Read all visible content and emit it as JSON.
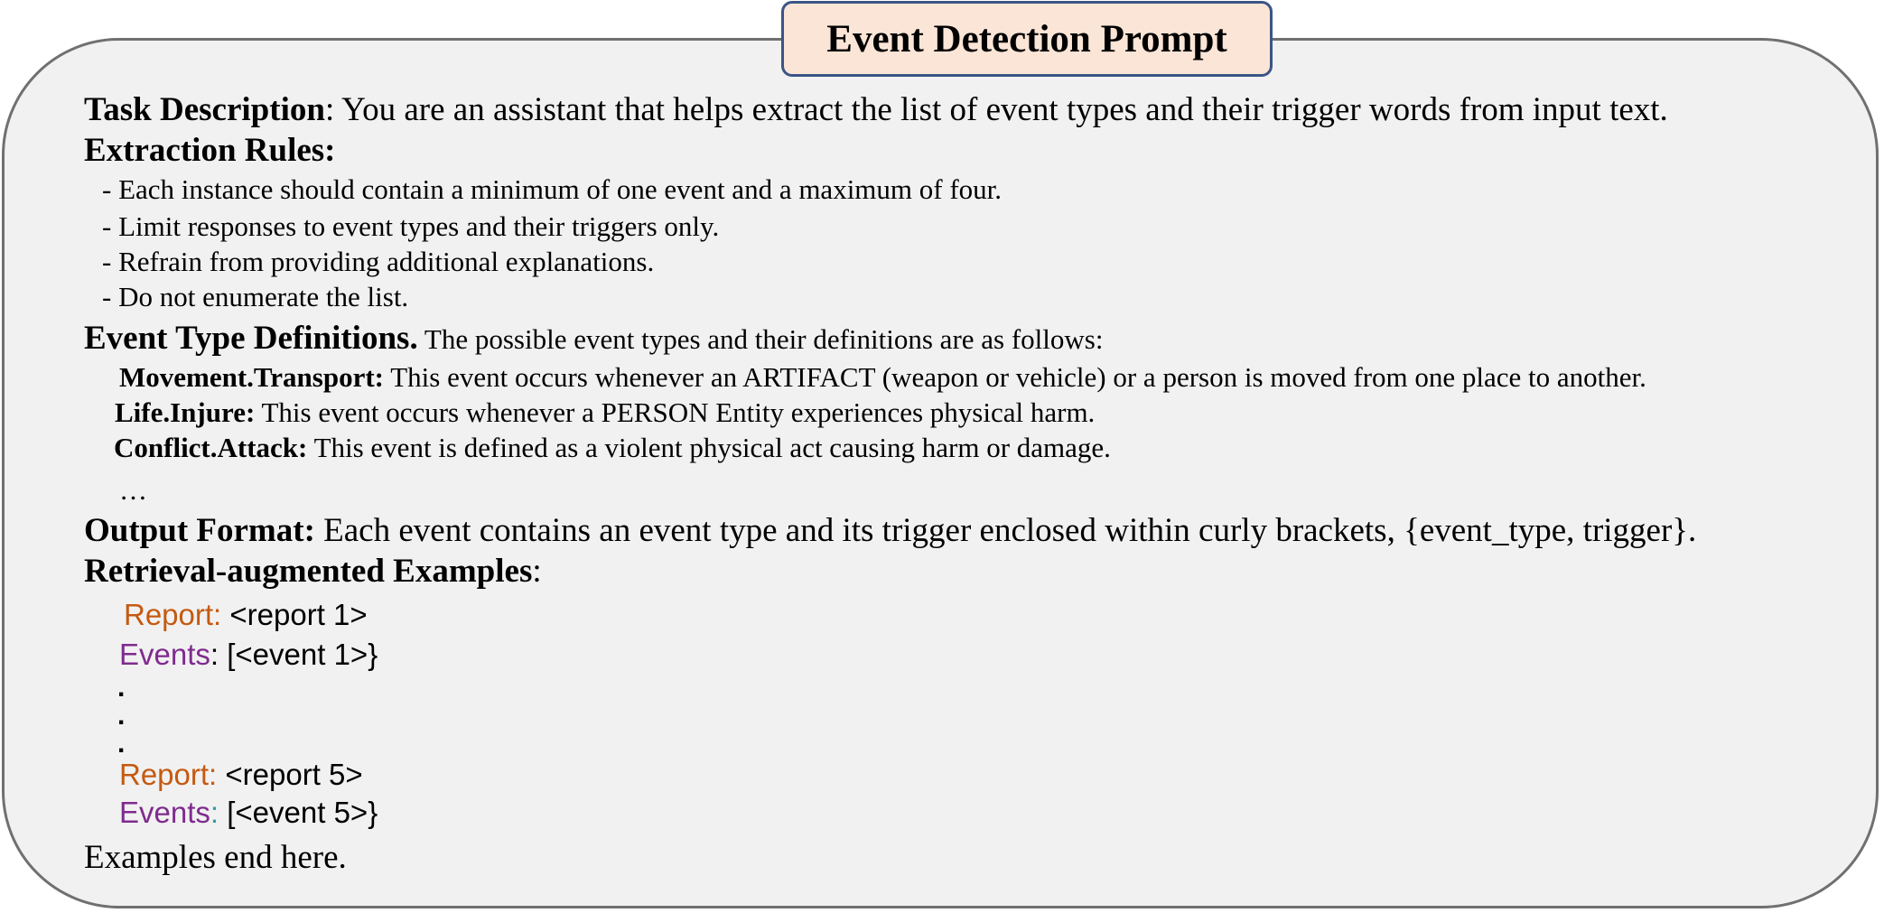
{
  "title": "Event Detection Prompt",
  "task": {
    "label": "Task Description",
    "text": ": You are an assistant that helps extract the list of event types and their trigger words from input text."
  },
  "rules": {
    "label": "Extraction Rules:",
    "items": [
      "- Each instance should contain a minimum of one event and a maximum of four.",
      "- Limit responses to event types and their triggers only.",
      "- Refrain from providing additional explanations.",
      "- Do not enumerate the list."
    ]
  },
  "definitions": {
    "label": "Event Type Definitions.",
    "intro": " The possible event types and their definitions are as follows:",
    "items": [
      {
        "name": "Movement.Transport:",
        "text": " This event occurs whenever an ARTIFACT (weapon or vehicle) or a person is moved from one place to another."
      },
      {
        "name": "Life.Injure:",
        "text": " This event occurs whenever a PERSON Entity experiences physical harm."
      },
      {
        "name": "Conflict.Attack:",
        "text": " This event is defined as a violent physical act causing harm or damage."
      }
    ],
    "ellipsis": "…"
  },
  "output": {
    "label": "Output Format:",
    "text": " Each event contains an event type and its trigger enclosed within curly brackets, {event_type, trigger}."
  },
  "examples": {
    "label": "Retrieval-augmented Examples",
    "colon": ":",
    "report_label": "Report:",
    "events_label": "Events",
    "colon_sep": ":",
    "report1": " <report 1>",
    "events1": " [<event 1>}",
    "dots": [
      ".",
      ".",
      "."
    ],
    "report5": " <report 5>",
    "events5": " [<event 5>}"
  },
  "closing": "Examples end here.",
  "colors": {
    "panel_bg": "#f1f1f1",
    "panel_border": "#707070",
    "title_bg": "#fbe5d6",
    "title_border": "#3b5586",
    "report": "#c55a11",
    "events": "#7f2b8e"
  }
}
